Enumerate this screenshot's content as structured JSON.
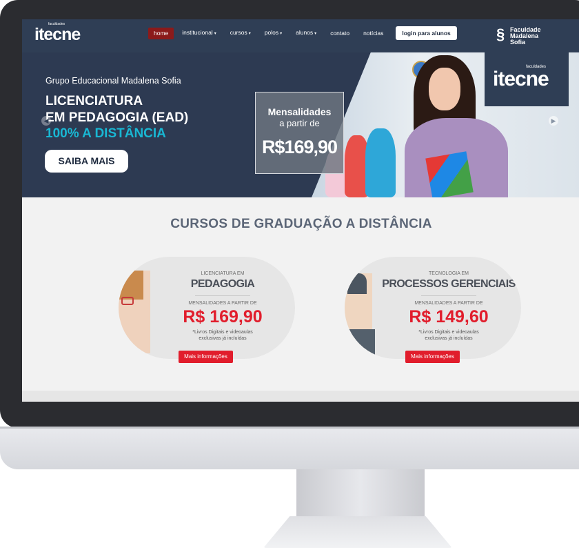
{
  "nav": {
    "logo": "itecne",
    "logo_small": "faculdades",
    "items": [
      {
        "label": "home",
        "caret": ""
      },
      {
        "label": "institucional",
        "caret": "▾"
      },
      {
        "label": "cursos",
        "caret": "▾"
      },
      {
        "label": "polos",
        "caret": "▾"
      },
      {
        "label": "alunos",
        "caret": "▾"
      },
      {
        "label": "contato",
        "caret": ""
      },
      {
        "label": "notícias",
        "caret": ""
      }
    ],
    "login_label": "login para alunos",
    "brand_right": [
      "Faculdade",
      "Madalena",
      "Sofia"
    ]
  },
  "hero": {
    "group": "Grupo Educacional Madalena Sofia",
    "line1": "LICENCIATURA",
    "line2": "EM PEDAGOGIA (EAD)",
    "line3": "100% A DISTÂNCIA",
    "cta": "SAIBA MAIS",
    "promo_title": "Mensalidades",
    "promo_sub": "a partir de",
    "promo_price": "R$169,90",
    "itecne": "itecne",
    "itecne_small": "faculdades"
  },
  "section": {
    "title": "CURSOS DE GRADUAÇÃO A DISTÂNCIA"
  },
  "courses": [
    {
      "eyebrow": "LICENCIATURA EM",
      "name": "PEDAGOGIA",
      "mensalidades": "MENSALIDADES A PARTIR DE",
      "price": "R$ 169,90",
      "note_line1": "*Livros Digitais e videoaulas",
      "note_line2": "exclusivas já incluídas",
      "button": "Mais informações"
    },
    {
      "eyebrow": "TECNOLOGIA EM",
      "name": "PROCESSOS GERENCIAIS",
      "mensalidades": "MENSALIDADES A PARTIR DE",
      "price": "R$ 149,60",
      "note_line1": "*Livros Digitais e videoaulas",
      "note_line2": "exclusivas já incluídas",
      "button": "Mais informações"
    }
  ],
  "colors": {
    "nav_bg": "#2f3e55",
    "accent_red": "#e11d2c",
    "accent_cyan": "#19b7d3",
    "active_menu": "#8b1a1a"
  }
}
